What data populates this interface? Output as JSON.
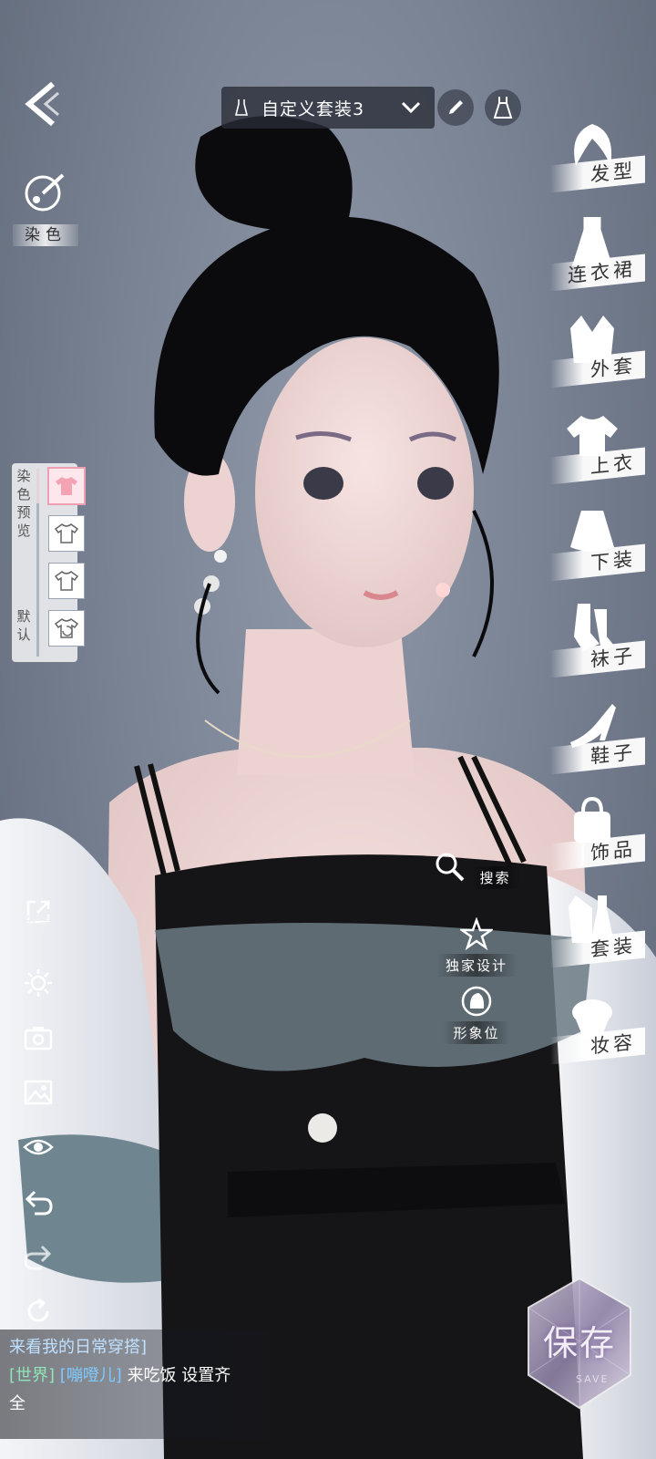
{
  "top_bar": {
    "outfit_name": "自定义套装3",
    "back_icon": "back-arrow-icon",
    "dropdown_icon": "chevron-down-icon",
    "pen_icon": "pen-icon",
    "dress_icon": "dress-icon"
  },
  "dye": {
    "label": "染色",
    "icon": "palette-brush-icon"
  },
  "dye_preview": {
    "label_chars": [
      "染",
      "色",
      "预",
      "览"
    ],
    "default_chars": [
      "默",
      "认"
    ],
    "slots": [
      "shirt-pink",
      "shirt-white",
      "shirt-white",
      "shirt-reset"
    ]
  },
  "categories": [
    {
      "label": "发型",
      "icon": "hair-icon"
    },
    {
      "label": "连衣裙",
      "icon": "dress-icon"
    },
    {
      "label": "外套",
      "icon": "coat-icon"
    },
    {
      "label": "上衣",
      "icon": "top-icon"
    },
    {
      "label": "下装",
      "icon": "skirt-icon"
    },
    {
      "label": "袜子",
      "icon": "socks-icon"
    },
    {
      "label": "鞋子",
      "icon": "heel-icon"
    },
    {
      "label": "饰品",
      "icon": "bag-icon"
    },
    {
      "label": "套装",
      "icon": "suit-icon"
    },
    {
      "label": "妆容",
      "icon": "makeup-icon"
    }
  ],
  "mid_actions": {
    "search": "搜索",
    "exclusive": "独家设计",
    "image_slot": "形象位"
  },
  "tools": {
    "share": "分享"
  },
  "chat": {
    "line1": "来看我的日常穿搭]",
    "channel": "[世界]",
    "nick": "[嘣噔儿]",
    "message": "来吃饭 设置齐",
    "message_cont": "全"
  },
  "save": {
    "label": "保存",
    "sub": "SAVE"
  },
  "colors": {
    "panel": "#ffffff",
    "accent_pink": "#ef9fb2",
    "chat_green": "#8fe5b7",
    "chat_blue": "#7fc9ff"
  }
}
